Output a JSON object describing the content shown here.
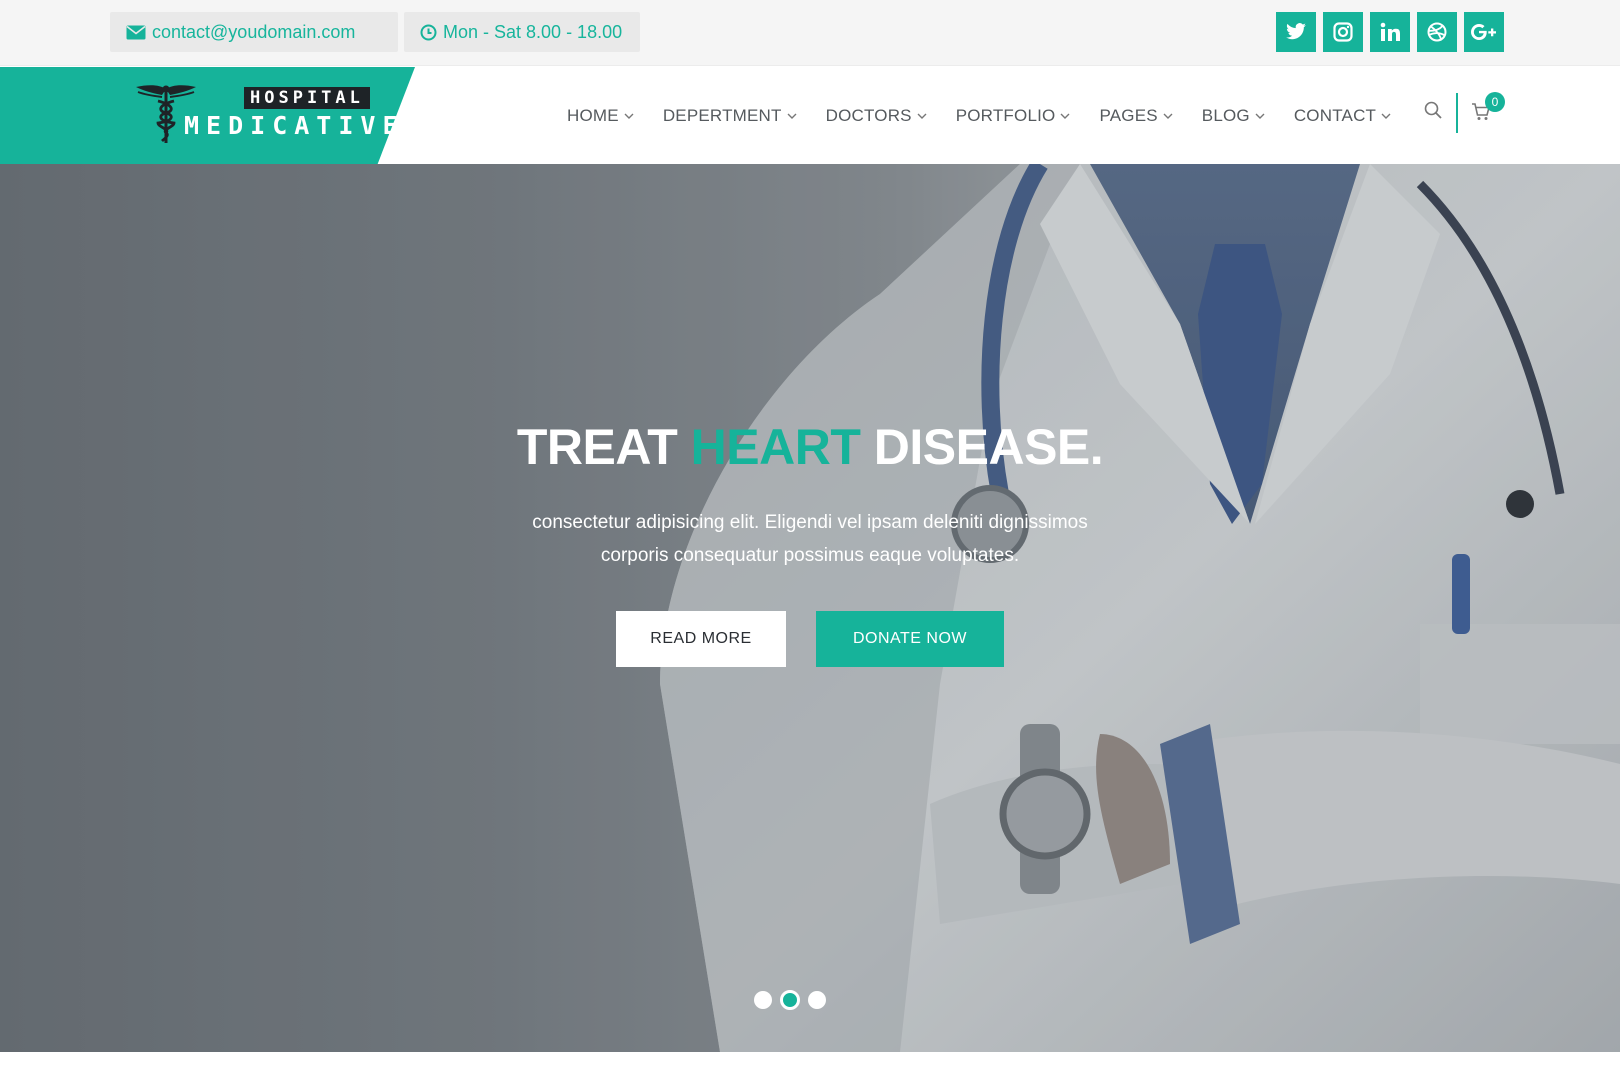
{
  "topbar": {
    "email": "contact@youdomain.com",
    "hours": "Mon - Sat 8.00 - 18.00",
    "socials": [
      "twitter-icon",
      "instagram-icon",
      "linkedin-icon",
      "dribbble-icon",
      "google-plus-icon"
    ]
  },
  "logo": {
    "tag": "HOSPITAL",
    "name": "MEDICATIVE"
  },
  "nav": {
    "items": [
      {
        "label": "HOME"
      },
      {
        "label": "DEPERTMENT"
      },
      {
        "label": "DOCTORS"
      },
      {
        "label": "PORTFOLIO"
      },
      {
        "label": "PAGES"
      },
      {
        "label": "BLOG"
      },
      {
        "label": "CONTACT"
      }
    ],
    "cart_count": "0"
  },
  "hero": {
    "title_part1": "TREAT ",
    "title_accent": "HEART",
    "title_part2": " DISEASE.",
    "subtitle_line1": "consectetur adipisicing elit. Eligendi vel ipsam deleniti dignissimos",
    "subtitle_line2": "corporis consequatur possimus eaque voluptates.",
    "read_more": "READ MORE",
    "donate": "DONATE NOW",
    "slides": 3,
    "active_slide": 2
  },
  "colors": {
    "accent": "#16b39a",
    "nav_text": "#555a5e",
    "topbar_bg": "#f5f5f5"
  }
}
